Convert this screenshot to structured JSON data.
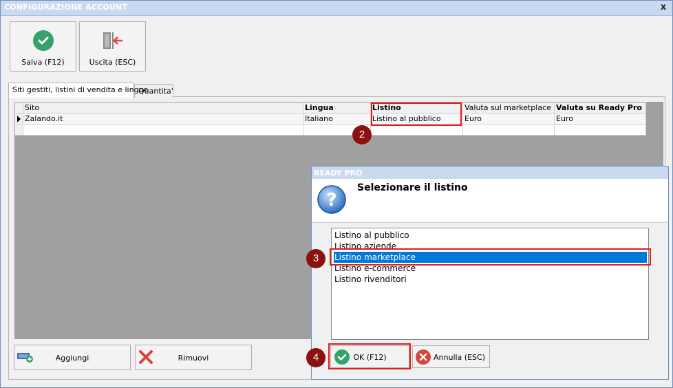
{
  "window": {
    "title": "CONFIGURAZIONE ACCOUNT",
    "close_glyph": "x"
  },
  "toolbar": {
    "save_label": "Salva (F12)",
    "exit_label": "Uscita (ESC)"
  },
  "tabs": [
    {
      "label": "Siti gestiti, listini di vendita e lingue",
      "active": true
    },
    {
      "label": "Quantita'",
      "active": false
    }
  ],
  "grid": {
    "columns": [
      "Sito",
      "Lingua",
      "Listino",
      "Valuta sul marketplace",
      "Valuta su Ready Pro"
    ],
    "rows": [
      [
        "Zalando.it",
        "Italiano",
        "Listino al pubblico",
        "Euro",
        "Euro"
      ]
    ]
  },
  "bottom_buttons": {
    "add_label": "Aggiungi",
    "remove_label": "Rimuovi"
  },
  "dialog": {
    "title": "READY PRO",
    "prompt": "Selezionare il listino",
    "options": [
      "Listino al pubblico",
      "Listino aziende",
      "Listino marketplace",
      "Listino e-commerce",
      "Listino rivenditori"
    ],
    "selected_index": 2,
    "ok_label": "OK (F12)",
    "cancel_label": "Annulla (ESC)"
  },
  "annotations": {
    "step2": "2",
    "step3": "3",
    "step4": "4"
  },
  "colors": {
    "accent_red": "#e31b1b",
    "badge": "#8b1010",
    "selection": "#0078d7",
    "ok_green": "#33a36a",
    "cancel_red": "#d9443a"
  }
}
